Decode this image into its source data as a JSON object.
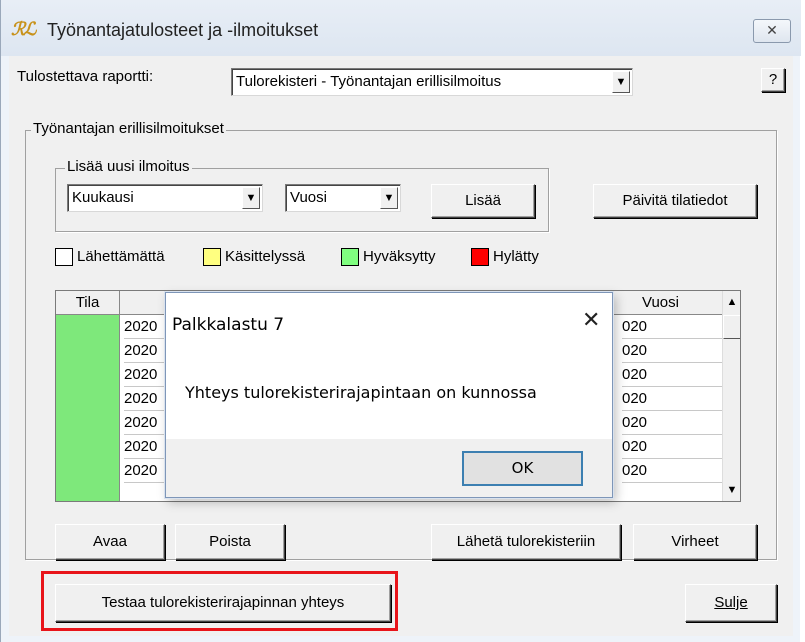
{
  "window": {
    "title": "Työnantajatulosteet ja -ilmoitukset",
    "icon_text": "ℛℒ",
    "close_glyph": "✕"
  },
  "report": {
    "label": "Tulostettava raportti:",
    "selected": "Tulorekisteri - Työnantajan erillisilmoitus",
    "help_label": "?"
  },
  "group_main": {
    "title": "Työnantajan erillisilmoitukset"
  },
  "group_add": {
    "title": "Lisää uusi ilmoitus",
    "period_selected": "Kuukausi",
    "year_selected": "Vuosi",
    "add_label": "Lisää"
  },
  "refresh_label": "Päivitä tilatiedot",
  "legend": [
    {
      "label": "Lähettämättä",
      "color": "#ffffff"
    },
    {
      "label": "Käsittelyssä",
      "color": "#ffff80"
    },
    {
      "label": "Hyväksytty",
      "color": "#80ff80"
    },
    {
      "label": "Hylätty",
      "color": "#ff0000"
    }
  ],
  "grid": {
    "columns": [
      "Tila",
      "",
      "",
      "Vuosi"
    ],
    "left_values": [
      "2020",
      "2020",
      "2020",
      "2020",
      "2020",
      "2020",
      "2020"
    ],
    "right_values": [
      "020",
      "020",
      "020",
      "020",
      "020",
      "020",
      "020"
    ],
    "status_color": "#7ee87b"
  },
  "buttons": {
    "open": "Avaa",
    "delete": "Poista",
    "send": "Lähetä tulorekisteriin",
    "errors": "Virheet",
    "test": "Testaa tulorekisterirajapinnan yhteys",
    "close": "Sulje"
  },
  "dialog": {
    "title": "Palkkalastu 7",
    "close_glyph": "✕",
    "message": "Yhteys tulorekisterirajapintaan on kunnossa",
    "ok_label": "OK"
  },
  "colors": {
    "highlight": "#e8141a",
    "accent_border": "#3c7fb1"
  }
}
